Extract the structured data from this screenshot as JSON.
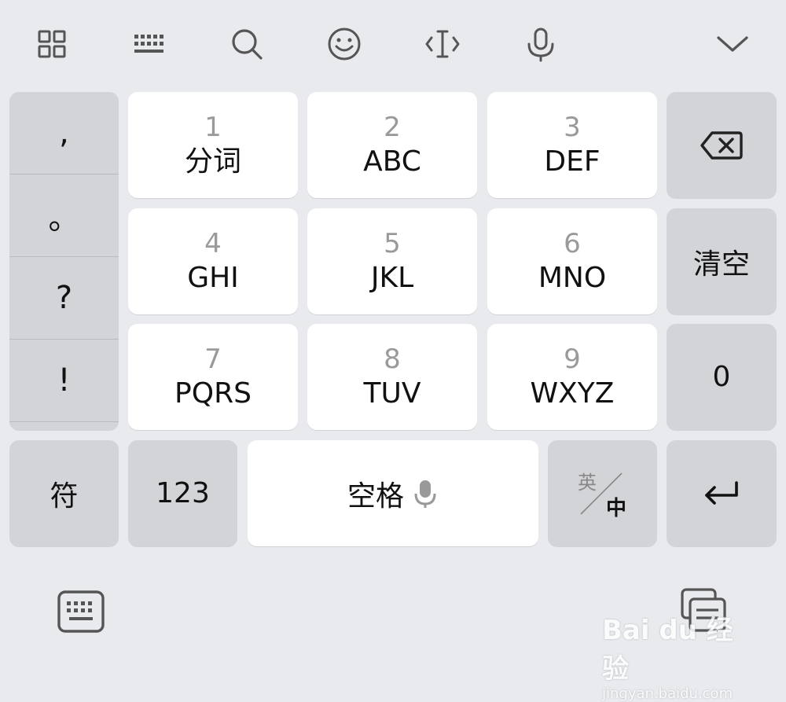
{
  "toolbar": {
    "icons": [
      "apps-grid-icon",
      "keyboard-layout-icon",
      "search-icon",
      "emoji-icon",
      "cursor-icon",
      "microphone-icon",
      "collapse-chevron-icon"
    ]
  },
  "punctuation": [
    ",",
    "。",
    "?",
    "!"
  ],
  "keys": [
    {
      "num": "1",
      "letters": "分词"
    },
    {
      "num": "2",
      "letters": "ABC"
    },
    {
      "num": "3",
      "letters": "DEF"
    },
    {
      "num": "4",
      "letters": "GHI"
    },
    {
      "num": "5",
      "letters": "JKL"
    },
    {
      "num": "6",
      "letters": "MNO"
    },
    {
      "num": "7",
      "letters": "PQRS"
    },
    {
      "num": "8",
      "letters": "TUV"
    },
    {
      "num": "9",
      "letters": "WXYZ"
    }
  ],
  "right": {
    "clear_label": "清空",
    "zero_label": "0"
  },
  "bottom_row": {
    "symbols_label": "符",
    "numeric_label": "123",
    "space_label": "空格",
    "lang_en": "英",
    "lang_zh": "中"
  },
  "watermark": {
    "main": "Bai du 经验",
    "sub": "jingyan.baidu.com"
  },
  "colors": {
    "background": "#e9eaee",
    "key_white": "#ffffff",
    "key_gray": "#d3d4d8",
    "icon": "#555555"
  }
}
